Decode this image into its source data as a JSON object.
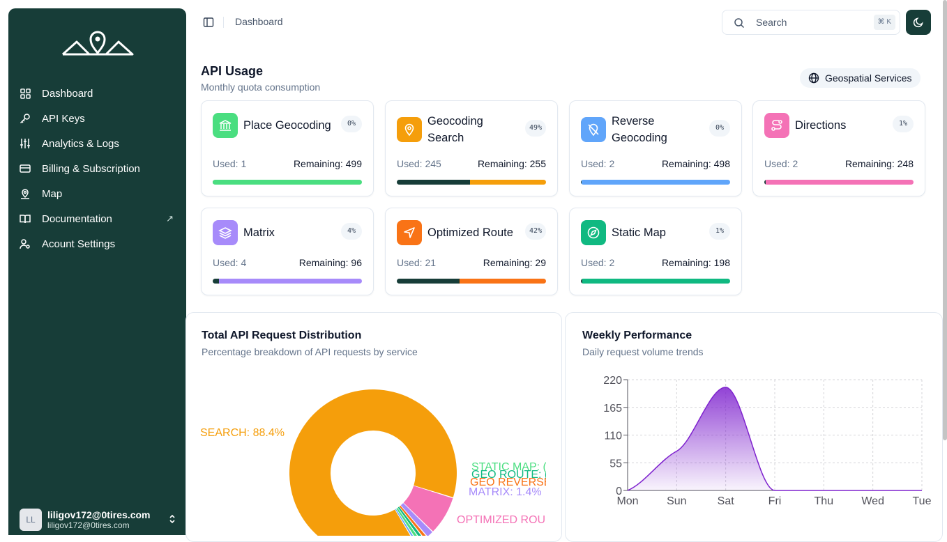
{
  "sidebar": {
    "items": [
      {
        "label": "Dashboard",
        "icon": "grid-icon"
      },
      {
        "label": "API Keys",
        "icon": "key-icon"
      },
      {
        "label": "Analytics & Logs",
        "icon": "sliders-icon"
      },
      {
        "label": "Billing & Subscription",
        "icon": "credit-card-icon"
      },
      {
        "label": "Map",
        "icon": "map-pin-icon"
      },
      {
        "label": "Documentation",
        "icon": "book-icon",
        "external": "↗"
      },
      {
        "label": "Acount Settings",
        "icon": "user-settings-icon"
      }
    ],
    "user": {
      "initials": "LL",
      "name": "liligov172@0tires.com",
      "email": "liligov172@0tires.com"
    }
  },
  "topbar": {
    "breadcrumb": "Dashboard",
    "search_placeholder": "Search",
    "search_shortcut": "⌘ K"
  },
  "usage": {
    "title": "API Usage",
    "subtitle": "Monthly quota consumption",
    "badge": "Geospatial Services",
    "cards": [
      {
        "name": "Place Geocoding",
        "pct": "0%",
        "used_label": "Used: 1",
        "remaining_label": "Remaining: 499",
        "used": 1,
        "quota": 500,
        "color": "#4ade80",
        "icon": "bank-icon"
      },
      {
        "name": "Geocoding Search",
        "pct": "49%",
        "used_label": "Used: 245",
        "remaining_label": "Remaining: 255",
        "used": 245,
        "quota": 500,
        "color": "#f59e0b",
        "icon": "map-pin-icon"
      },
      {
        "name": "Reverse Geocoding",
        "pct": "0%",
        "used_label": "Used: 2",
        "remaining_label": "Remaining: 498",
        "used": 2,
        "quota": 500,
        "color": "#60a5fa",
        "icon": "pin-off-icon"
      },
      {
        "name": "Directions",
        "pct": "1%",
        "used_label": "Used: 2",
        "remaining_label": "Remaining: 248",
        "used": 2,
        "quota": 250,
        "color": "#f472b6",
        "icon": "route-icon"
      },
      {
        "name": "Matrix",
        "pct": "4%",
        "used_label": "Used: 4",
        "remaining_label": "Remaining: 96",
        "used": 4,
        "quota": 100,
        "color": "#a78bfa",
        "icon": "layers-icon"
      },
      {
        "name": "Optimized Route",
        "pct": "42%",
        "used_label": "Used: 21",
        "remaining_label": "Remaining: 29",
        "used": 21,
        "quota": 50,
        "color": "#f97316",
        "icon": "navigation-icon"
      },
      {
        "name": "Static Map",
        "pct": "1%",
        "used_label": "Used: 2",
        "remaining_label": "Remaining: 198",
        "used": 2,
        "quota": 200,
        "color": "#10b981",
        "icon": "compass-icon"
      }
    ]
  },
  "distribution": {
    "title": "Total API Request Distribution",
    "subtitle": "Percentage breakdown of API requests by service"
  },
  "weekly": {
    "title": "Weekly Performance",
    "subtitle": "Daily request volume trends"
  },
  "chart_data": [
    {
      "type": "pie",
      "title": "Total API Request Distribution",
      "slices": [
        {
          "label": "SEARCH: 88.4%",
          "value": 88.4,
          "color": "#f59e0b"
        },
        {
          "label": "OPTIMIZED ROU",
          "value": 7.6,
          "color": "#f472b6"
        },
        {
          "label": "MATRIX: 1.4%",
          "value": 1.4,
          "color": "#a78bfa"
        },
        {
          "label": "GEO REVERSE",
          "value": 0.7,
          "color": "#f97316"
        },
        {
          "label": "GEO ROUTE: (",
          "value": 0.7,
          "color": "#10b981"
        },
        {
          "label": "STATIC MAP: (",
          "value": 0.7,
          "color": "#4ade80"
        },
        {
          "label": "",
          "value": 0.5,
          "color": "#60a5fa"
        }
      ]
    },
    {
      "type": "area",
      "title": "Weekly Performance",
      "categories": [
        "Mon",
        "Sun",
        "Sat",
        "Fri",
        "Thu",
        "Wed",
        "Tue"
      ],
      "values": [
        0,
        78,
        205,
        0,
        0,
        0,
        0
      ],
      "yticks": [
        0,
        55,
        110,
        165,
        220
      ],
      "ylim": [
        0,
        220
      ],
      "grid": true,
      "color": "#7e22ce"
    }
  ]
}
